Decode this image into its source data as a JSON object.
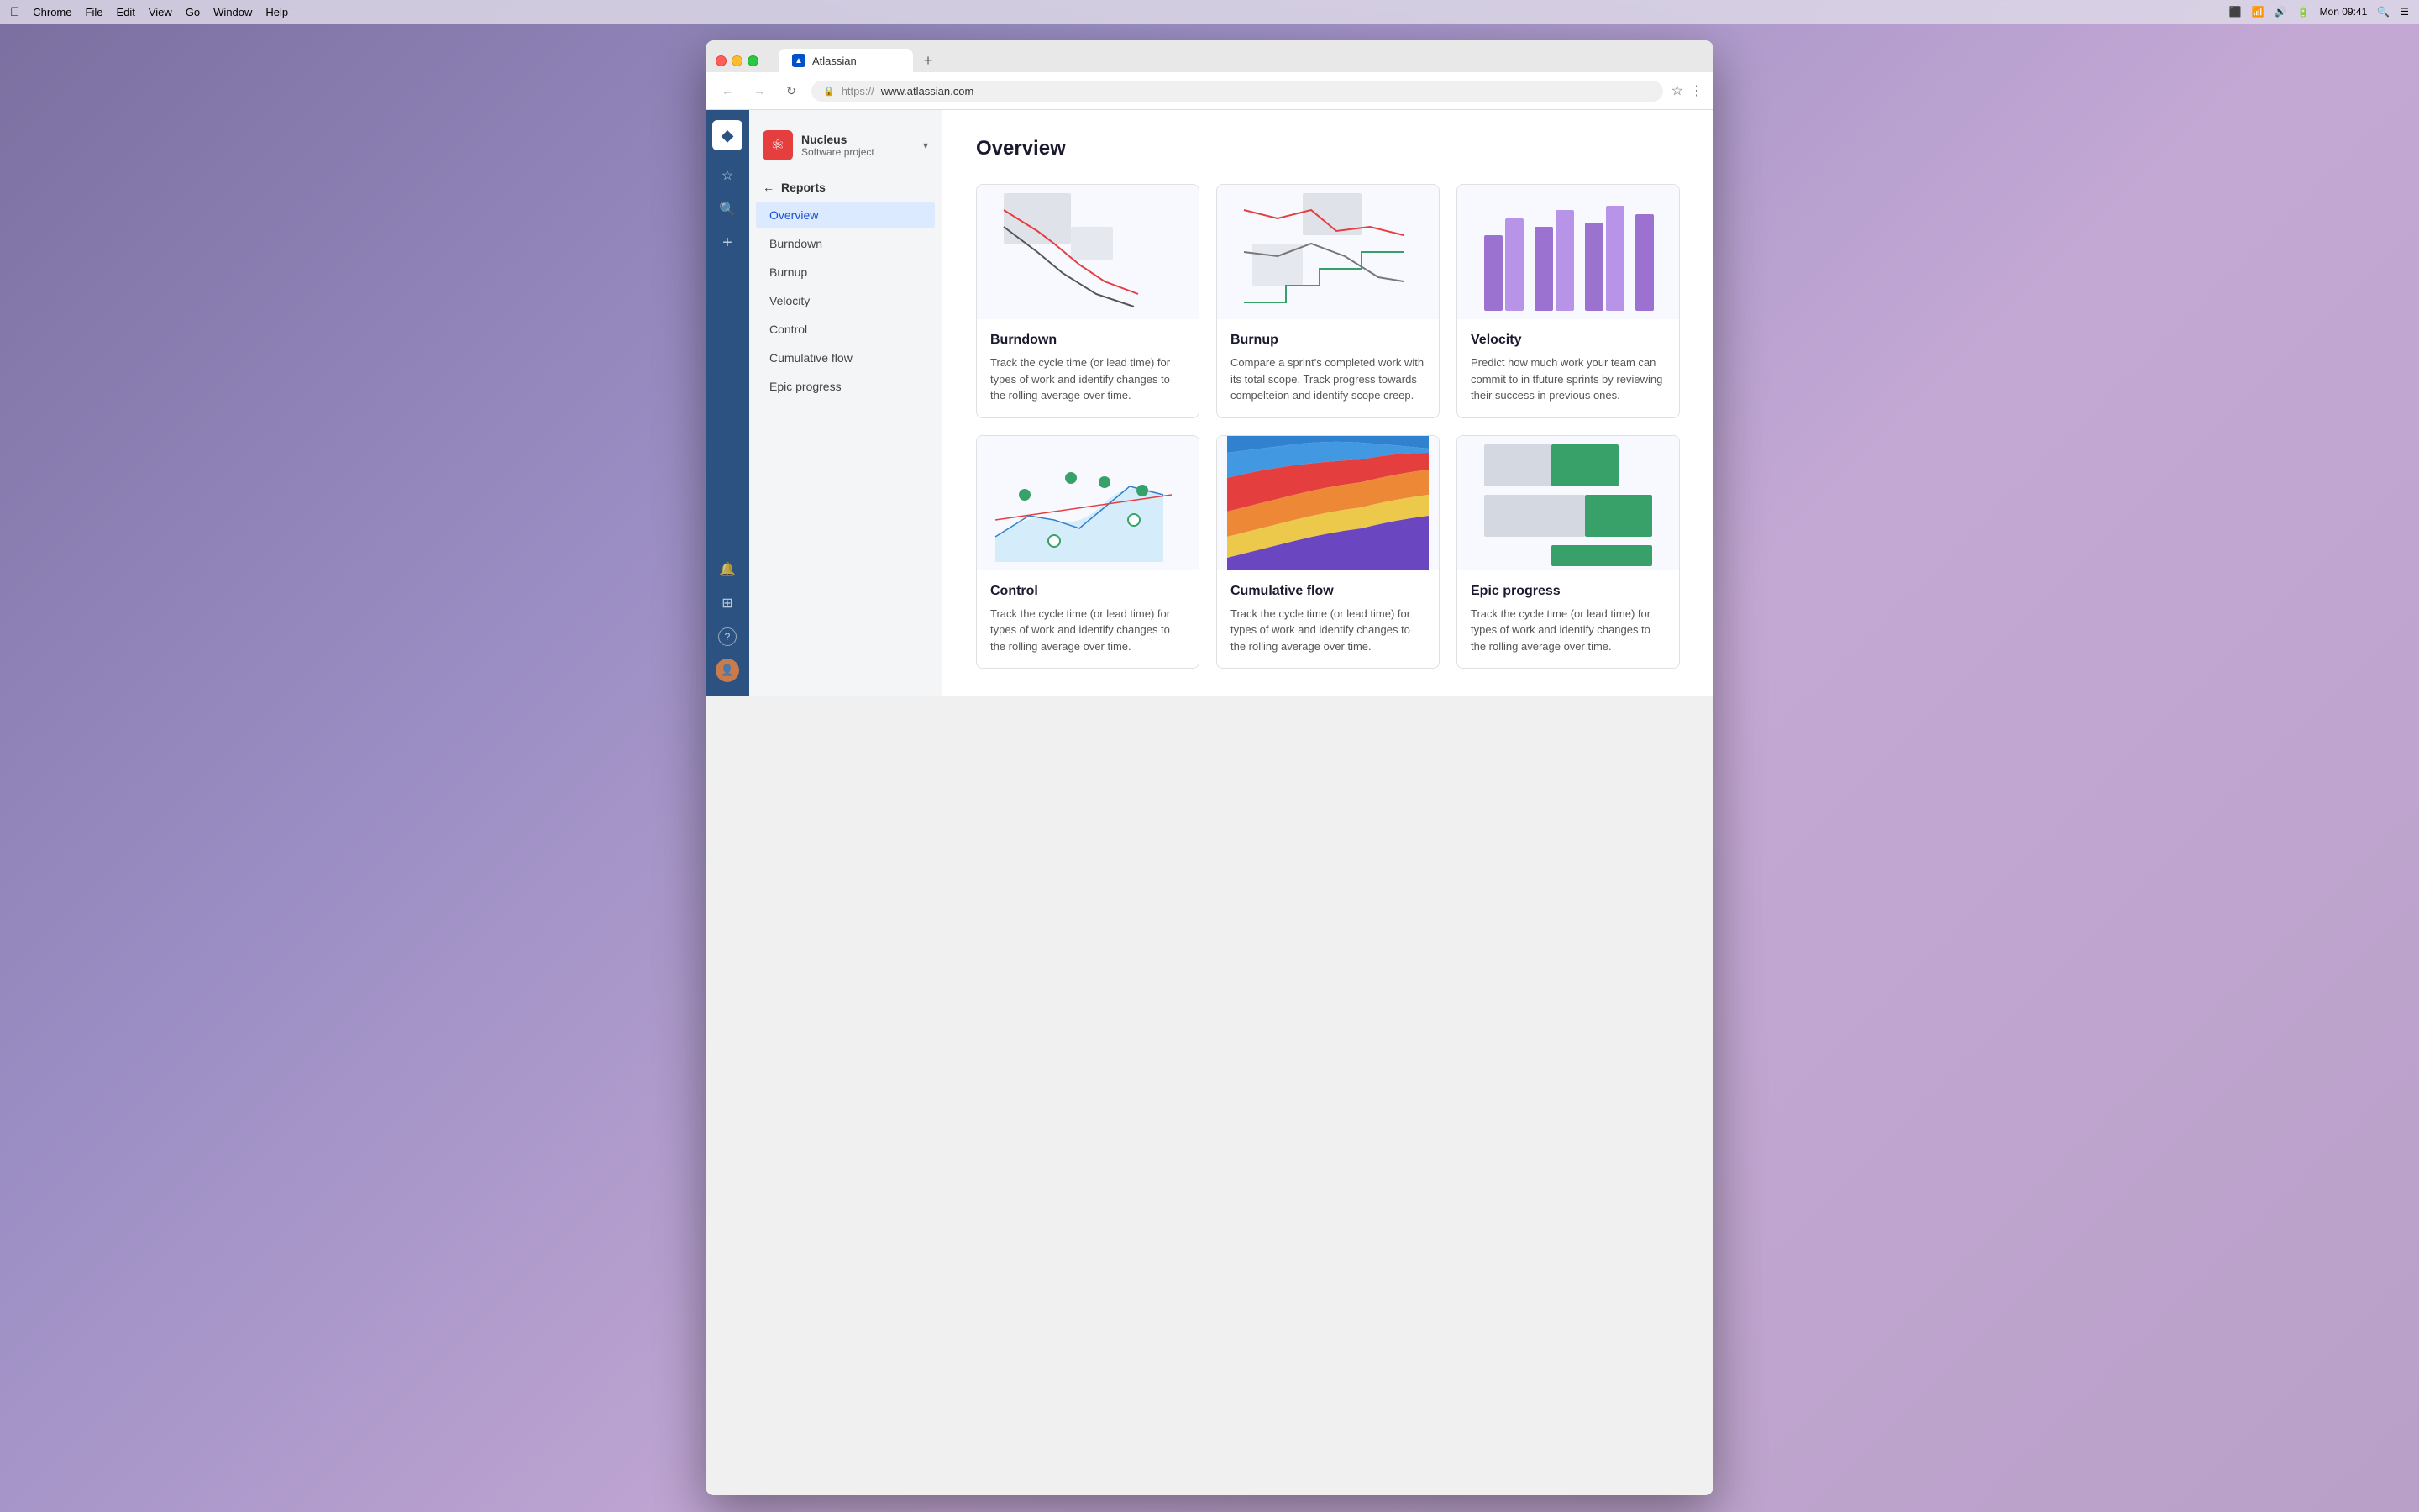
{
  "menubar": {
    "apple": "⌘",
    "items": [
      "Chrome",
      "File",
      "Edit",
      "View",
      "Go",
      "Window",
      "Help"
    ],
    "time": "Mon 09:41",
    "icons": [
      "cast-icon",
      "wifi-icon",
      "volume-icon",
      "battery-icon",
      "search-icon",
      "menu-icon"
    ]
  },
  "browser": {
    "tab": {
      "favicon": "A",
      "title": "Atlassian"
    },
    "add_tab_label": "+",
    "url_protocol": "https://",
    "url_host": "www.atlassian.com"
  },
  "sidebar": {
    "logo": "◆",
    "icons": [
      {
        "name": "star-icon",
        "symbol": "☆"
      },
      {
        "name": "search-icon",
        "symbol": "🔍"
      },
      {
        "name": "plus-icon",
        "symbol": "+"
      },
      {
        "name": "bell-icon",
        "symbol": "🔔"
      },
      {
        "name": "grid-icon",
        "symbol": "⊞"
      },
      {
        "name": "help-icon",
        "symbol": "?"
      },
      {
        "name": "avatar-icon",
        "symbol": "👤"
      }
    ]
  },
  "nav": {
    "project_icon": "⚛",
    "project_name": "Nucleus",
    "project_type": "Software project",
    "back_label": "Reports",
    "items": [
      {
        "label": "Overview",
        "active": true
      },
      {
        "label": "Burndown",
        "active": false
      },
      {
        "label": "Burnup",
        "active": false
      },
      {
        "label": "Velocity",
        "active": false
      },
      {
        "label": "Control",
        "active": false
      },
      {
        "label": "Cumulative flow",
        "active": false
      },
      {
        "label": "Epic progress",
        "active": false
      }
    ]
  },
  "main": {
    "title": "Overview",
    "cards": [
      {
        "id": "burndown",
        "title": "Burndown",
        "title_bold": false,
        "description": "Track the cycle time (or lead time) for types of work and identify changes to the rolling average over time.",
        "chart_type": "burndown"
      },
      {
        "id": "burnup",
        "title": "Burnup",
        "title_bold": false,
        "description": "Compare a sprint's completed work with its total scope. Track progress towards compelteion and identify scope creep.",
        "chart_type": "burnup"
      },
      {
        "id": "velocity",
        "title": "Velocity",
        "title_bold": false,
        "description": "Predict how much work your team can commit to in tfuture sprints by reviewing their success in previous ones.",
        "chart_type": "velocity"
      },
      {
        "id": "control",
        "title": "Control",
        "title_bold": true,
        "description": "Track the cycle time (or lead time) for types of work and identify changes to the rolling average over time.",
        "chart_type": "control"
      },
      {
        "id": "cumulative-flow",
        "title": "Cumulative flow",
        "title_bold": false,
        "description": "Track the cycle time (or lead time) for types of work and identify changes to the rolling average over time.",
        "chart_type": "cumulative"
      },
      {
        "id": "epic-progress",
        "title": "Epic progress",
        "title_bold": false,
        "description": "Track the cycle time (or lead time) for types of work and identify changes to the rolling average over time.",
        "chart_type": "epic"
      }
    ]
  }
}
